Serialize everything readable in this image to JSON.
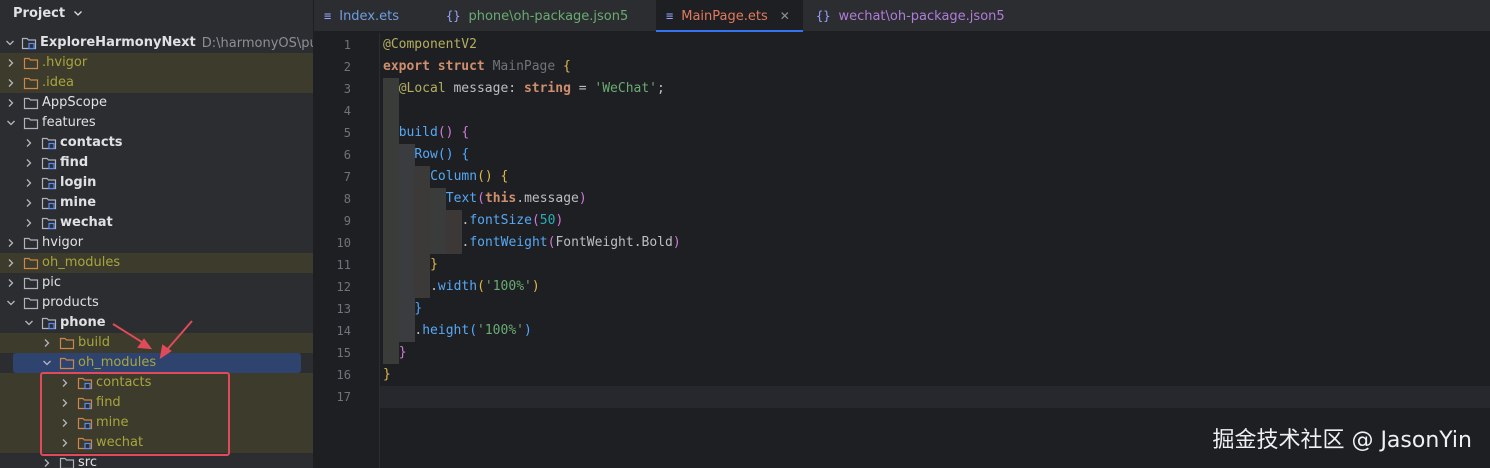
{
  "project_panel": {
    "title": "Project",
    "tree": [
      {
        "label": "ExploreHarmonyNext",
        "path": "D:\\harmonyOS\\public\\Ex",
        "depth": 0,
        "expanded": true,
        "kind": "project",
        "bold": true
      },
      {
        "label": ".hvigor",
        "depth": 0,
        "expanded": false,
        "kind": "folder-orange",
        "excluded": true
      },
      {
        "label": ".idea",
        "depth": 0,
        "expanded": false,
        "kind": "folder-orange",
        "excluded": true
      },
      {
        "label": "AppScope",
        "depth": 0,
        "expanded": false,
        "kind": "folder"
      },
      {
        "label": "features",
        "depth": 0,
        "expanded": true,
        "kind": "folder"
      },
      {
        "label": "contacts",
        "depth": 1,
        "expanded": false,
        "kind": "module",
        "bold": true
      },
      {
        "label": "find",
        "depth": 1,
        "expanded": false,
        "kind": "module",
        "bold": true
      },
      {
        "label": "login",
        "depth": 1,
        "expanded": false,
        "kind": "module",
        "bold": true
      },
      {
        "label": "mine",
        "depth": 1,
        "expanded": false,
        "kind": "module",
        "bold": true
      },
      {
        "label": "wechat",
        "depth": 1,
        "expanded": false,
        "kind": "module",
        "bold": true
      },
      {
        "label": "hvigor",
        "depth": 0,
        "expanded": false,
        "kind": "folder"
      },
      {
        "label": "oh_modules",
        "depth": 0,
        "expanded": false,
        "kind": "folder-orange",
        "excluded": true
      },
      {
        "label": "pic",
        "depth": 0,
        "expanded": false,
        "kind": "folder"
      },
      {
        "label": "products",
        "depth": 0,
        "expanded": true,
        "kind": "folder"
      },
      {
        "label": "phone",
        "depth": 1,
        "expanded": true,
        "kind": "module",
        "bold": true
      },
      {
        "label": "build",
        "depth": 2,
        "expanded": false,
        "kind": "folder-orange",
        "excluded": true
      },
      {
        "label": "oh_modules",
        "depth": 2,
        "expanded": true,
        "kind": "folder-orange",
        "excluded": true,
        "selected": true
      },
      {
        "label": "contacts",
        "depth": 3,
        "expanded": false,
        "kind": "module-orange",
        "excluded": true
      },
      {
        "label": "find",
        "depth": 3,
        "expanded": false,
        "kind": "module-orange",
        "excluded": true
      },
      {
        "label": "mine",
        "depth": 3,
        "expanded": false,
        "kind": "module-orange",
        "excluded": true
      },
      {
        "label": "wechat",
        "depth": 3,
        "expanded": false,
        "kind": "module-orange",
        "excluded": true
      },
      {
        "label": "src",
        "depth": 2,
        "expanded": false,
        "kind": "folder"
      }
    ]
  },
  "tabs": [
    {
      "label": "Index.ets",
      "icon": "ets-file-icon",
      "style": "blue"
    },
    {
      "label": "phone\\oh-package.json5",
      "icon": "json-file-icon",
      "style": "green"
    },
    {
      "label": "MainPage.ets",
      "icon": "ets-file-icon",
      "style": "orange",
      "active": true,
      "close": "✕"
    },
    {
      "label": "wechat\\oh-package.json5",
      "icon": "json-file-icon",
      "style": "purple"
    }
  ],
  "editor": {
    "caret_line": 17,
    "lines": [
      {
        "n": "1",
        "indent": 0,
        "tokens": [
          [
            "ann",
            "@ComponentV2"
          ]
        ]
      },
      {
        "n": "2",
        "indent": 0,
        "tokens": [
          [
            "kw",
            "export"
          ],
          [
            "",
            " "
          ],
          [
            "kw",
            "struct"
          ],
          [
            "",
            " "
          ],
          [
            "cls",
            "MainPage"
          ],
          [
            "",
            " "
          ],
          [
            "b1",
            "{"
          ]
        ]
      },
      {
        "n": "3",
        "indent": 1,
        "tokens": [
          [
            "ann",
            "@Local"
          ],
          [
            "",
            " message: "
          ],
          [
            "kw",
            "string"
          ],
          [
            "",
            " = "
          ],
          [
            "str",
            "'WeChat'"
          ],
          [
            "",
            ";"
          ]
        ]
      },
      {
        "n": "4",
        "indent": 1,
        "tokens": []
      },
      {
        "n": "5",
        "indent": 1,
        "tokens": [
          [
            "fn",
            "build"
          ],
          [
            "b2",
            "()"
          ],
          [
            "",
            " "
          ],
          [
            "b2",
            "{"
          ]
        ]
      },
      {
        "n": "6",
        "indent": 2,
        "tokens": [
          [
            "fn",
            "Row"
          ],
          [
            "b3",
            "()"
          ],
          [
            "",
            " "
          ],
          [
            "b3",
            "{"
          ]
        ]
      },
      {
        "n": "7",
        "indent": 3,
        "tokens": [
          [
            "fn",
            "Column"
          ],
          [
            "b1",
            "()"
          ],
          [
            "",
            " "
          ],
          [
            "b1",
            "{"
          ]
        ]
      },
      {
        "n": "8",
        "indent": 4,
        "tokens": [
          [
            "fn",
            "Text"
          ],
          [
            "b2",
            "("
          ],
          [
            "this",
            "this"
          ],
          [
            "",
            ".message"
          ],
          [
            "b2",
            ")"
          ]
        ]
      },
      {
        "n": "9",
        "indent": 5,
        "tokens": [
          [
            "",
            "."
          ],
          [
            "fn",
            "fontSize"
          ],
          [
            "b2",
            "("
          ],
          [
            "num",
            "50"
          ],
          [
            "b2",
            ")"
          ]
        ]
      },
      {
        "n": "10",
        "indent": 5,
        "tokens": [
          [
            "",
            "."
          ],
          [
            "fn",
            "fontWeight"
          ],
          [
            "b2",
            "("
          ],
          [
            "",
            "FontWeight.Bold"
          ],
          [
            "b2",
            ")"
          ]
        ]
      },
      {
        "n": "11",
        "indent": 3,
        "tokens": [
          [
            "b1",
            "}"
          ]
        ]
      },
      {
        "n": "12",
        "indent": 3,
        "tokens": [
          [
            "",
            "."
          ],
          [
            "fn",
            "width"
          ],
          [
            "b1",
            "("
          ],
          [
            "str",
            "'100%'"
          ],
          [
            "b1",
            ")"
          ]
        ]
      },
      {
        "n": "13",
        "indent": 2,
        "tokens": [
          [
            "b3",
            "}"
          ]
        ]
      },
      {
        "n": "14",
        "indent": 2,
        "tokens": [
          [
            "",
            "."
          ],
          [
            "fn",
            "height"
          ],
          [
            "b3",
            "("
          ],
          [
            "str",
            "'100%'"
          ],
          [
            "b3",
            ")"
          ]
        ]
      },
      {
        "n": "15",
        "indent": 1,
        "tokens": [
          [
            "b2",
            "}"
          ]
        ]
      },
      {
        "n": "16",
        "indent": 0,
        "tokens": [
          [
            "b1",
            "}"
          ]
        ]
      },
      {
        "n": "17",
        "indent": 0,
        "tokens": []
      }
    ]
  },
  "watermark": "掘金技术社区 @ JasonYin",
  "colors": {
    "panel_bg": "#2b2d30",
    "editor_bg": "#1e1f22",
    "selection": "#2e436e",
    "excluded_text": "#a9a53d",
    "annotation_red": "#e04a5a"
  }
}
